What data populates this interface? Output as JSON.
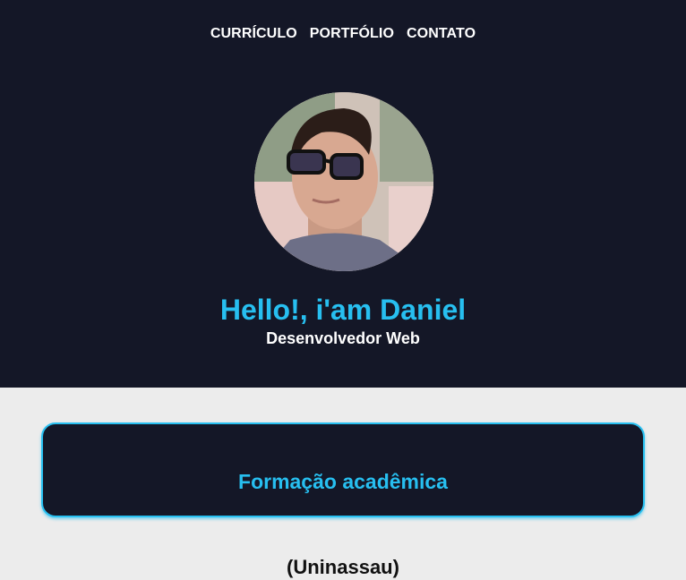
{
  "nav": {
    "items": [
      "CURRÍCULO",
      "PORTFÓLIO",
      "CONTATO"
    ]
  },
  "profile": {
    "photo_icon": "profile-photo",
    "greeting": "Hello!, i'am Daniel",
    "role": "Desenvolvedor Web"
  },
  "section": {
    "title": "Formação acadêmica",
    "institution": "(Uninassau)"
  },
  "colors": {
    "header_bg": "#141727",
    "accent": "#27bff0",
    "page_bg": "#ececec"
  }
}
